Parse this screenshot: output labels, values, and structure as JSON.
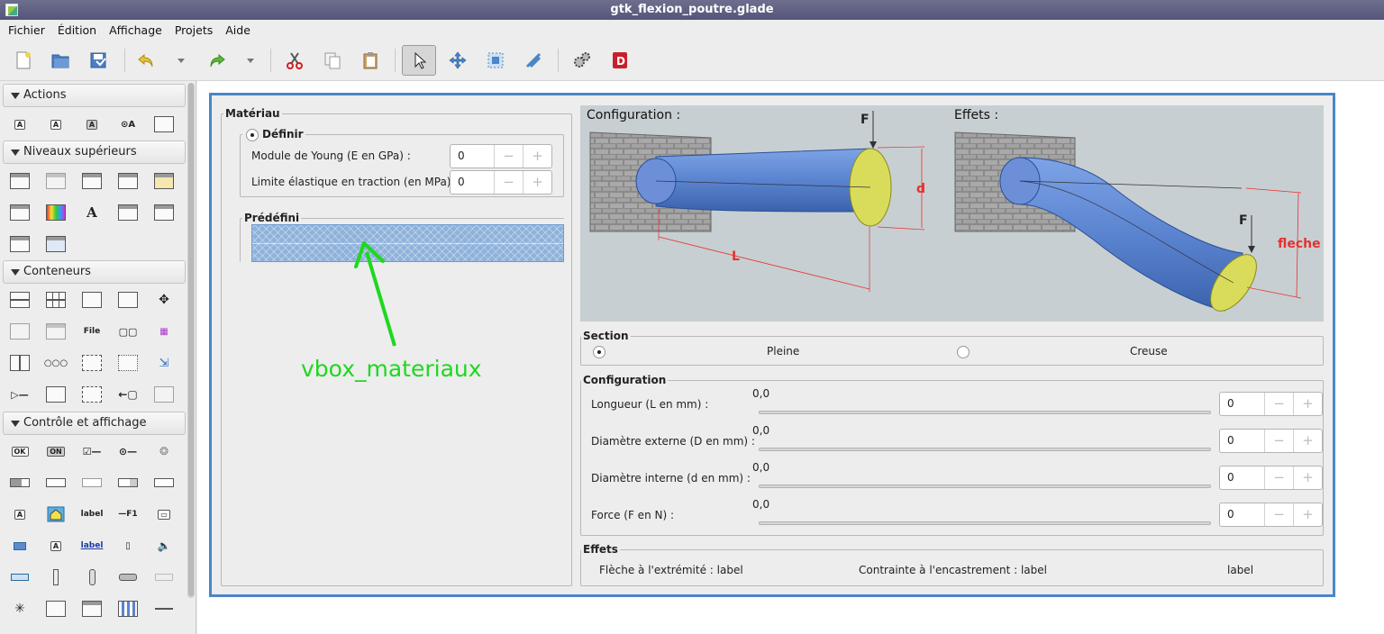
{
  "window": {
    "title": "gtk_flexion_poutre.glade"
  },
  "menubar": [
    "Fichier",
    "Édition",
    "Affichage",
    "Projets",
    "Aide"
  ],
  "toolbar": {
    "icons": [
      "new-file-icon",
      "open-file-icon",
      "save-file-icon",
      "undo-icon",
      "undo-dropdown-icon",
      "redo-icon",
      "redo-dropdown-icon",
      "cut-icon",
      "copy-icon",
      "paste-icon",
      "select-pointer-icon",
      "drag-resize-icon",
      "margin-edit-icon",
      "alignment-edit-icon",
      "preferences-icon",
      "devhelp-icon"
    ],
    "active": "select-pointer-icon"
  },
  "palette": {
    "sections": [
      {
        "label": "Actions"
      },
      {
        "label": "Niveaux supérieurs"
      },
      {
        "label": "Conteneurs"
      },
      {
        "label": "Contrôle et affichage"
      }
    ],
    "icon_texts": {
      "file": "File",
      "ok": "OK",
      "on": "ON",
      "label": "label",
      "f1": "—F1",
      "a": "A"
    }
  },
  "materiau": {
    "title": "Matériau",
    "definir": {
      "title": "Définir",
      "young_label": "Module de Young (E en GPa) :",
      "young_value": "0",
      "limite_label": "Limite élastique en traction (en MPa) :",
      "limite_value": "0"
    },
    "predefini": {
      "title": "Prédéfini"
    }
  },
  "annotation": {
    "label": "vbox_materiaux",
    "color": "#1ed81e"
  },
  "image": {
    "config_title": "Configuration :",
    "effets_title": "Effets :",
    "force": "F",
    "diameter": "d",
    "length": "L",
    "fleche": "fleche"
  },
  "section": {
    "title": "Section",
    "options": [
      {
        "label": "Pleine",
        "selected": true
      },
      {
        "label": "Creuse",
        "selected": false
      }
    ]
  },
  "configuration": {
    "title": "Configuration",
    "rows": [
      {
        "label": "Longueur (L en mm) :",
        "scale_value": "0,0",
        "spin_value": "0"
      },
      {
        "label": "Diamètre externe (D en mm) :",
        "scale_value": "0,0",
        "spin_value": "0"
      },
      {
        "label": "Diamètre interne (d en mm) :",
        "scale_value": "0,0",
        "spin_value": "0"
      },
      {
        "label": "Force (F en N) :",
        "scale_value": "0,0",
        "spin_value": "0"
      }
    ]
  },
  "effets": {
    "title": "Effets",
    "fleche_label": "Flèche à l'extrémité : label",
    "contrainte_label": "Contrainte à l'encastrement  : label",
    "third_label": "label"
  },
  "spin_buttons": {
    "minus": "−",
    "plus": "+"
  },
  "colors": {
    "selection": "#4a86c8",
    "beam": "#5b84d0",
    "beam_end": "#d9dc5a",
    "dimension": "#e83030"
  }
}
